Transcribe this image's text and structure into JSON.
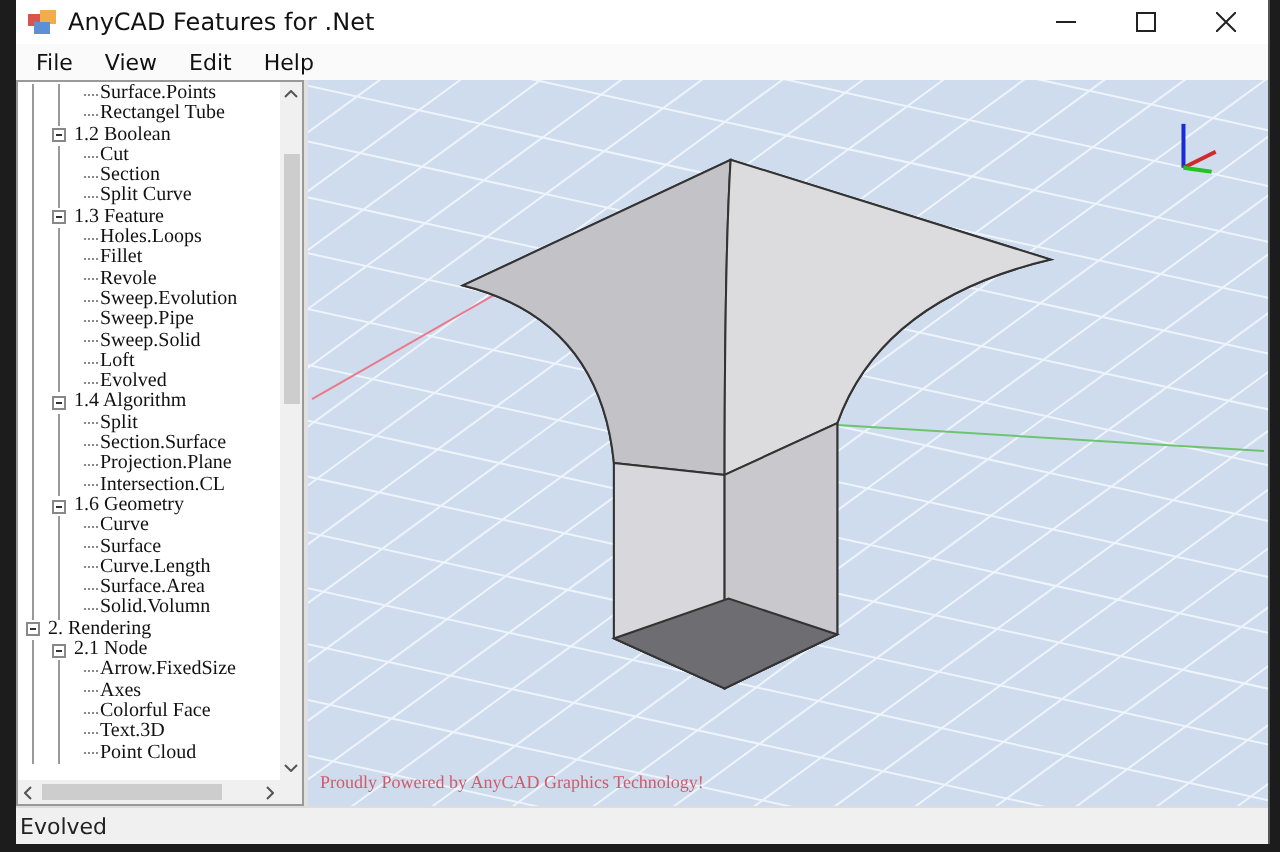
{
  "window": {
    "title": "AnyCAD Features for .Net"
  },
  "menu": [
    "File",
    "View",
    "Edit",
    "Help"
  ],
  "tree": {
    "items": [
      {
        "children": [
          {
            "children": [
              {
                "label": "Surface.Points"
              },
              {
                "label": "Rectangel Tube"
              }
            ]
          },
          {
            "label": "1.2 Boolean",
            "expanded": true,
            "children": [
              {
                "label": "Cut"
              },
              {
                "label": "Section"
              },
              {
                "label": "Split Curve"
              }
            ]
          },
          {
            "label": "1.3 Feature",
            "expanded": true,
            "children": [
              {
                "label": "Holes.Loops"
              },
              {
                "label": "Fillet"
              },
              {
                "label": "Revole"
              },
              {
                "label": "Sweep.Evolution"
              },
              {
                "label": "Sweep.Pipe"
              },
              {
                "label": "Sweep.Solid"
              },
              {
                "label": "Loft"
              },
              {
                "label": "Evolved"
              }
            ]
          },
          {
            "label": "1.4 Algorithm",
            "expanded": true,
            "children": [
              {
                "label": "Split"
              },
              {
                "label": "Section.Surface"
              },
              {
                "label": "Projection.Plane"
              },
              {
                "label": "Intersection.CL"
              }
            ]
          },
          {
            "label": "1.6 Geometry",
            "expanded": true,
            "children": [
              {
                "label": "Curve"
              },
              {
                "label": "Surface"
              },
              {
                "label": "Curve.Length"
              },
              {
                "label": "Surface.Area"
              },
              {
                "label": "Solid.Volumn"
              }
            ]
          }
        ]
      },
      {
        "label": "2. Rendering",
        "expanded": true,
        "children": [
          {
            "label": "2.1 Node",
            "expanded": true,
            "children": [
              {
                "label": "Arrow.FixedSize"
              },
              {
                "label": "Axes"
              },
              {
                "label": "Colorful Face"
              },
              {
                "label": "Text.3D"
              },
              {
                "label": "Point Cloud"
              }
            ]
          }
        ]
      }
    ]
  },
  "viewport": {
    "caption": "Proudly Powered by AnyCAD Graphics Technology!"
  },
  "status_bar": "Evolved"
}
